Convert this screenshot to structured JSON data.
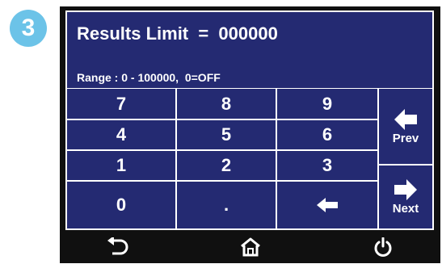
{
  "step": {
    "number": "3",
    "color": "#6cc3e8"
  },
  "screen": {
    "background": "#242a72",
    "title": "Results Limit  =  000000",
    "range": "Range : 0 - 100000,  0=OFF"
  },
  "keypad": {
    "rows": [
      [
        "7",
        "8",
        "9"
      ],
      [
        "4",
        "5",
        "6"
      ],
      [
        "1",
        "2",
        "3"
      ],
      [
        "0",
        ".",
        "backspace-arrow-icon"
      ]
    ]
  },
  "side_buttons": {
    "prev_label": "Prev",
    "next_label": "Next"
  },
  "bottom_bar": {
    "icons": [
      "back-arrow-icon",
      "home-icon",
      "power-icon"
    ]
  }
}
